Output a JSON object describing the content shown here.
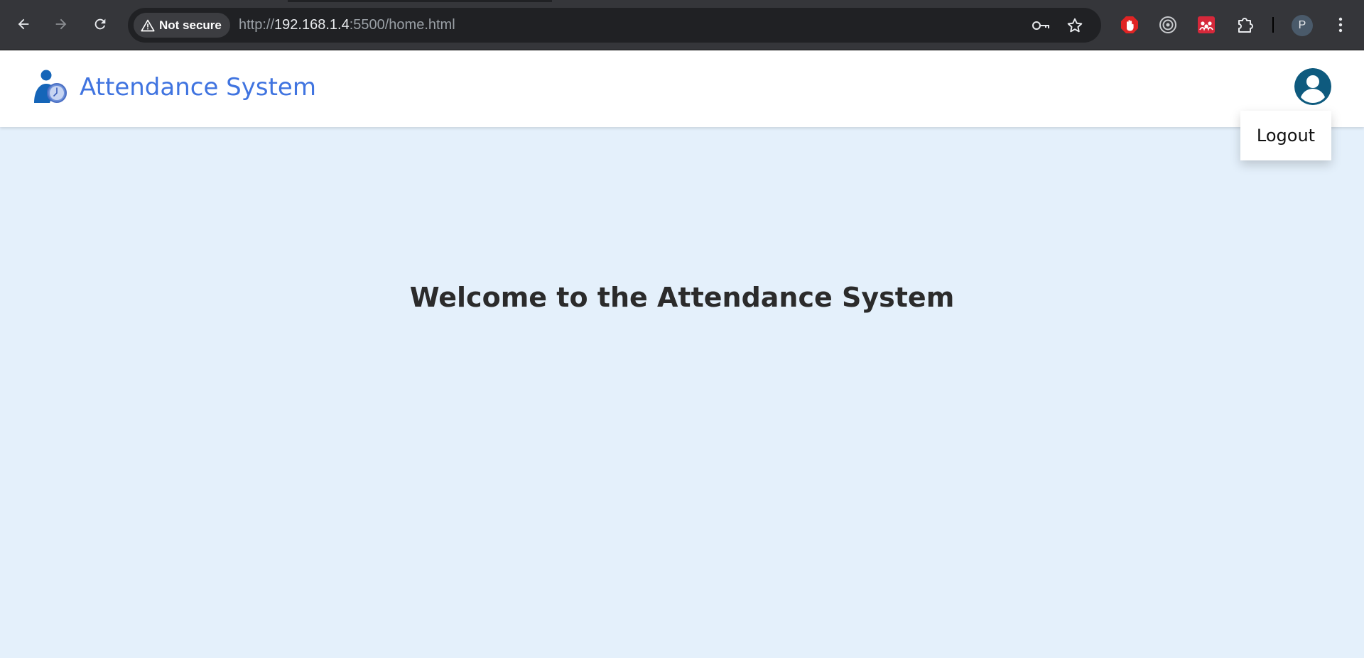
{
  "browser": {
    "security_label": "Not secure",
    "url": {
      "scheme": "http://",
      "host": "192.168.1.4",
      "rest": ":5500/home.html"
    },
    "profile_initial": "P"
  },
  "header": {
    "title": "Attendance System",
    "title_color": "#4074e0"
  },
  "user_menu": {
    "items": [
      {
        "label": "Logout"
      }
    ]
  },
  "main": {
    "heading": "Welcome to the Attendance System"
  },
  "colors": {
    "page_background": "#e4f0fb",
    "chrome_background": "#35363a",
    "avatar": "#0e5a7e"
  },
  "icons": {
    "back": "arrow-left-icon",
    "forward": "arrow-right-icon",
    "reload": "reload-icon",
    "warning": "warning-triangle-icon",
    "password": "key-icon",
    "bookmark": "star-icon",
    "extensions": [
      "adblock-hand-icon",
      "target-circle-icon",
      "mendeley-icon",
      "puzzle-piece-icon"
    ],
    "menu": "kebab-menu-icon",
    "avatar": "user-avatar-icon"
  }
}
